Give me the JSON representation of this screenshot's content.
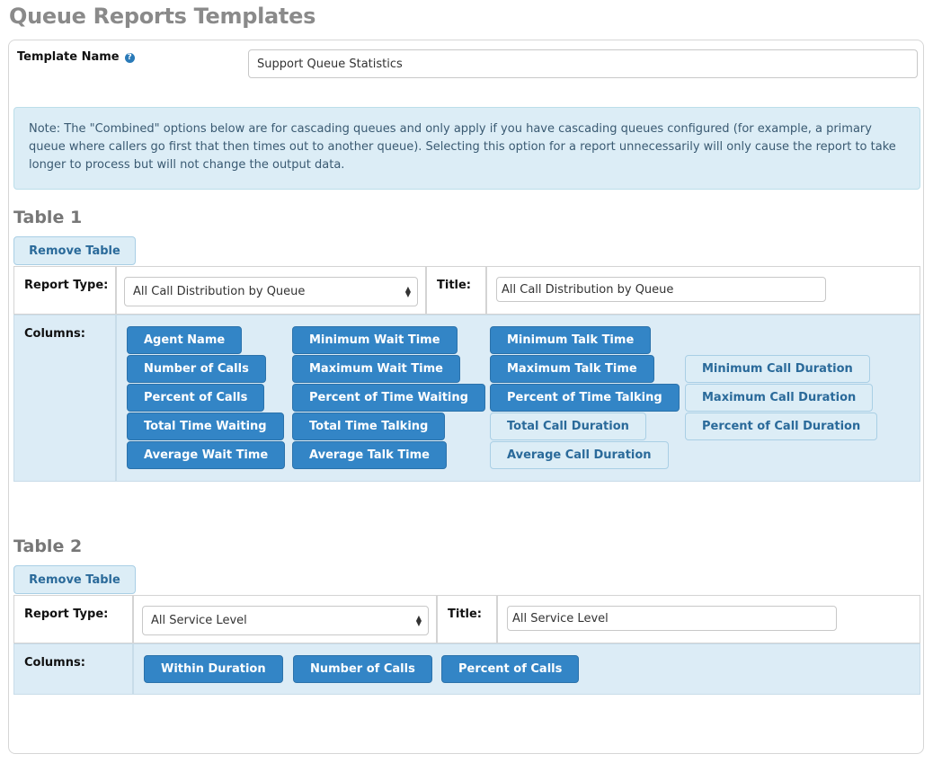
{
  "page": {
    "title": "Queue Reports Templates"
  },
  "template": {
    "label": "Template Name",
    "help_icon": "question-circle-icon",
    "help_glyph": "?",
    "value": "Support Queue Statistics"
  },
  "note": "Note: The \"Combined\" options below are for cascading queues and only apply if you have cascading queues configured (for example, a primary queue where callers go first that then times out to another queue). Selecting this option for a report unnecessarily will only cause the report to take longer to process but will not change the output data.",
  "tables": [
    {
      "heading": "Table 1",
      "remove_label": "Remove Table",
      "report_type_label": "Report Type:",
      "report_type_value": "All Call Distribution by Queue",
      "title_label": "Title:",
      "title_value": "All Call Distribution by Queue",
      "columns_label": "Columns:",
      "columns": [
        {
          "label": "Agent Name",
          "selected": true
        },
        {
          "label": "Number of Calls",
          "selected": true
        },
        {
          "label": "Percent of Calls",
          "selected": true
        },
        {
          "label": "Total Time Waiting",
          "selected": true
        },
        {
          "label": "Average Wait Time",
          "selected": true
        },
        {
          "label": "Minimum Wait Time",
          "selected": true
        },
        {
          "label": "Maximum Wait Time",
          "selected": true
        },
        {
          "label": "Percent of Time Waiting",
          "selected": true
        },
        {
          "label": "Total Time Talking",
          "selected": true
        },
        {
          "label": "Average Talk Time",
          "selected": true
        },
        {
          "label": "Minimum Talk Time",
          "selected": true
        },
        {
          "label": "Maximum Talk Time",
          "selected": true
        },
        {
          "label": "Percent of Time Talking",
          "selected": true
        },
        {
          "label": "Total Call Duration",
          "selected": false
        },
        {
          "label": "Average Call Duration",
          "selected": false
        },
        {
          "label": "Minimum Call Duration",
          "selected": false
        },
        {
          "label": "Maximum Call Duration",
          "selected": false
        },
        {
          "label": "Percent of Call Duration",
          "selected": false
        }
      ]
    },
    {
      "heading": "Table 2",
      "remove_label": "Remove Table",
      "report_type_label": "Report Type:",
      "report_type_value": "All Service Level",
      "title_label": "Title:",
      "title_value": "All Service Level",
      "columns_label": "Columns:",
      "columns": [
        {
          "label": "Within Duration",
          "selected": true
        },
        {
          "label": "Number of Calls",
          "selected": true
        },
        {
          "label": "Percent of Calls",
          "selected": true
        }
      ]
    }
  ],
  "colors": {
    "chip_selected": "#3385c6",
    "chip_unselected": "#dcedf6",
    "note_background": "#dcedf6",
    "title_gray": "#8a8a8a"
  },
  "icons": {
    "select_arrows": "up-down-arrows-icon"
  }
}
